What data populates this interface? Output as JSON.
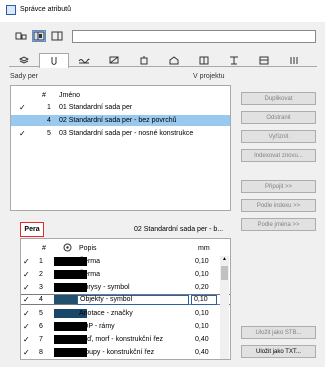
{
  "window": {
    "title": "Správce atributů"
  },
  "search": {
    "value": ""
  },
  "sets_panel": {
    "label": "Sady per",
    "project_label": "V projektu",
    "col_num": "#",
    "col_name": "Jméno",
    "rows": [
      {
        "num": "1",
        "name": "01 Standardní sada per",
        "checked": true,
        "selected": false
      },
      {
        "num": "4",
        "name": "02 Standardní sada per - bez povrchů",
        "checked": false,
        "selected": true
      },
      {
        "num": "5",
        "name": "03 Standardní sada per - nosné konstrukce",
        "checked": true,
        "selected": false
      }
    ]
  },
  "buttons": {
    "duplicate": "Duplikovat",
    "delete": "Odstranit",
    "cut": "Vyříznit",
    "index": "Indexovat znovu...",
    "attach": "Připojit >>",
    "by_index": "Podle indexu >>",
    "by_name": "Podle jména >>",
    "save_stb": "Uložit jako STB...",
    "save_txt": "Uložit jako TXT..."
  },
  "pens_panel": {
    "tab_label": "Pera",
    "set_name": "02 Standardní sada per - b...",
    "col_num": "#",
    "col_desc": "Popis",
    "col_mm": "mm",
    "rows": [
      {
        "num": "1",
        "color": "#000000",
        "desc": "Čerma",
        "mm": "0,10",
        "checked": true
      },
      {
        "num": "2",
        "color": "#000000",
        "desc": "Čerma",
        "mm": "0,10",
        "checked": true
      },
      {
        "num": "3",
        "color": "#000000",
        "desc": "Obrysy - symbol",
        "mm": "0,20",
        "checked": true
      },
      {
        "num": "4",
        "color": "#22506e",
        "desc": "Objekty - symbol",
        "mm": "0,10",
        "checked": true,
        "editing": true
      },
      {
        "num": "5",
        "color": "#19476a",
        "desc": "Anotace - značky",
        "mm": "0,10",
        "checked": true
      },
      {
        "num": "6",
        "color": "#000000",
        "desc": "LOP - rámy",
        "mm": "0,10",
        "checked": true
      },
      {
        "num": "7",
        "color": "#000000",
        "desc": "Zeď, morf - konstrukční řez",
        "mm": "0,40",
        "checked": true
      },
      {
        "num": "8",
        "color": "#000000",
        "desc": "Sloupy - konstrukční řez",
        "mm": "0,40",
        "checked": true
      }
    ]
  }
}
